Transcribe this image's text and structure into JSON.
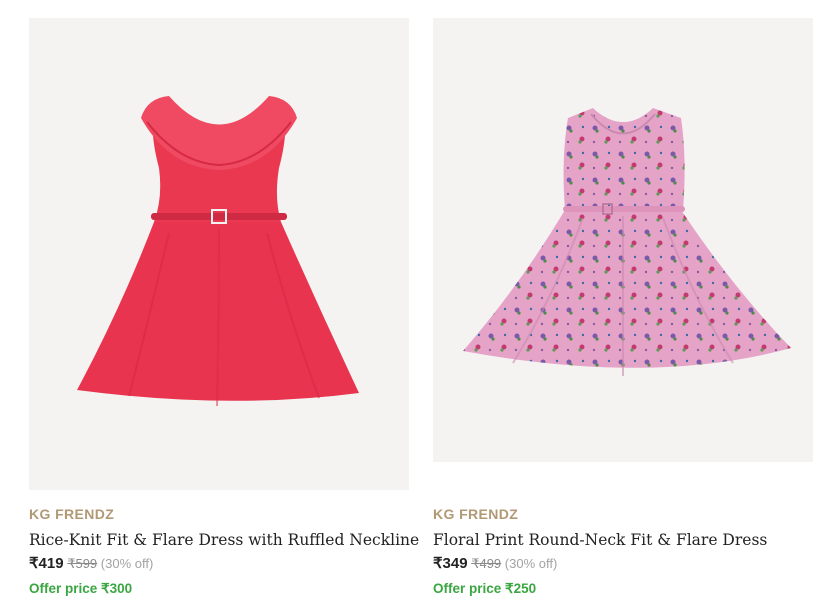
{
  "products": [
    {
      "brand": "KG FRENDZ",
      "title": "Rice-Knit Fit & Flare Dress with Ruffled Neckline",
      "price": "₹419",
      "mrp": "₹599",
      "discount": "(30% off)",
      "offer": "Offer price ₹300",
      "image": "red-ruffled-dress-image",
      "dress_color": "#e8344f"
    },
    {
      "brand": "KG FRENDZ",
      "title": "Floral Print Round-Neck Fit & Flare Dress",
      "price": "₹349",
      "mrp": "₹499",
      "discount": "(30% off)",
      "offer": "Offer price ₹250",
      "image": "pink-floral-dress-image",
      "dress_color": "#e6a3c8"
    }
  ],
  "colors": {
    "brand": "#b19975",
    "offer": "#3aa641",
    "image_bg": "#f4f3f2"
  }
}
